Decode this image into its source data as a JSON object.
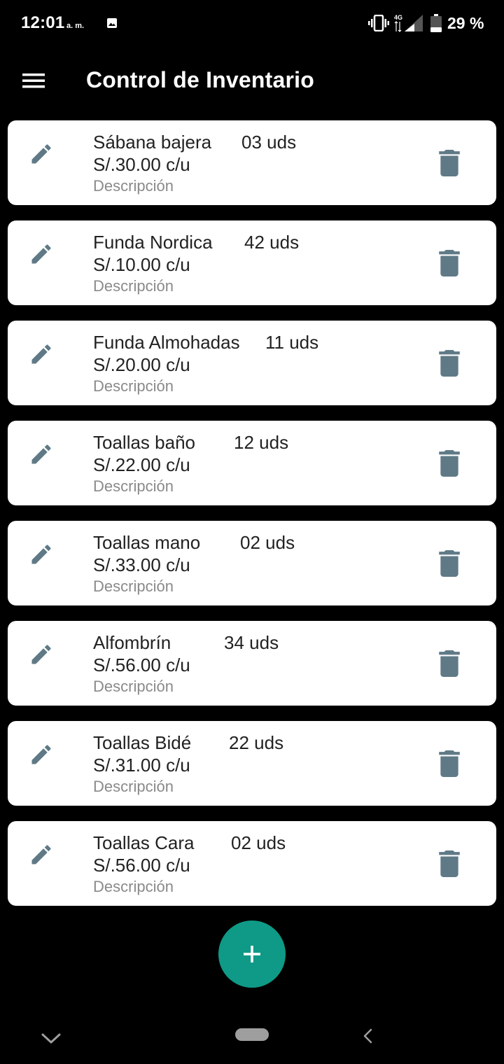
{
  "status_bar": {
    "time": "12:01",
    "ampm": "a. m.",
    "network": "4G",
    "battery": "29 %"
  },
  "app_bar": {
    "title": "Control de Inventario",
    "menu_icon": "hamburger-menu-icon"
  },
  "items": [
    {
      "name": "Sábana bajera",
      "qty": "03 uds",
      "price": "S/.30.00 c/u",
      "description": "Descripción"
    },
    {
      "name": "Funda Nordica",
      "qty": "42 uds",
      "price": "S/.10.00 c/u",
      "description": "Descripción"
    },
    {
      "name": "Funda Almohadas",
      "qty": "11 uds",
      "price": "S/.20.00 c/u",
      "description": "Descripción"
    },
    {
      "name": "Toallas baño",
      "qty": "12 uds",
      "price": "S/.22.00 c/u",
      "description": "Descripción"
    },
    {
      "name": "Toallas mano",
      "qty": "02 uds",
      "price": "S/.33.00 c/u",
      "description": "Descripción"
    },
    {
      "name": "Alfombrín",
      "qty": "34 uds",
      "price": "S/.56.00 c/u",
      "description": "Descripción"
    },
    {
      "name": "Toallas Bidé",
      "qty": "22 uds",
      "price": "S/.31.00 c/u",
      "description": "Descripción"
    },
    {
      "name": "Toallas Cara",
      "qty": "02 uds",
      "price": "S/.56.00 c/u",
      "description": "Descripción"
    }
  ],
  "icons": {
    "edit": "pencil-icon",
    "delete": "trash-icon",
    "fab": "plus-icon"
  },
  "colors": {
    "background": "#000000",
    "card": "#ffffff",
    "icon": "#5f7a86",
    "fab": "#0e9a86",
    "description": "#8a8a8a"
  }
}
